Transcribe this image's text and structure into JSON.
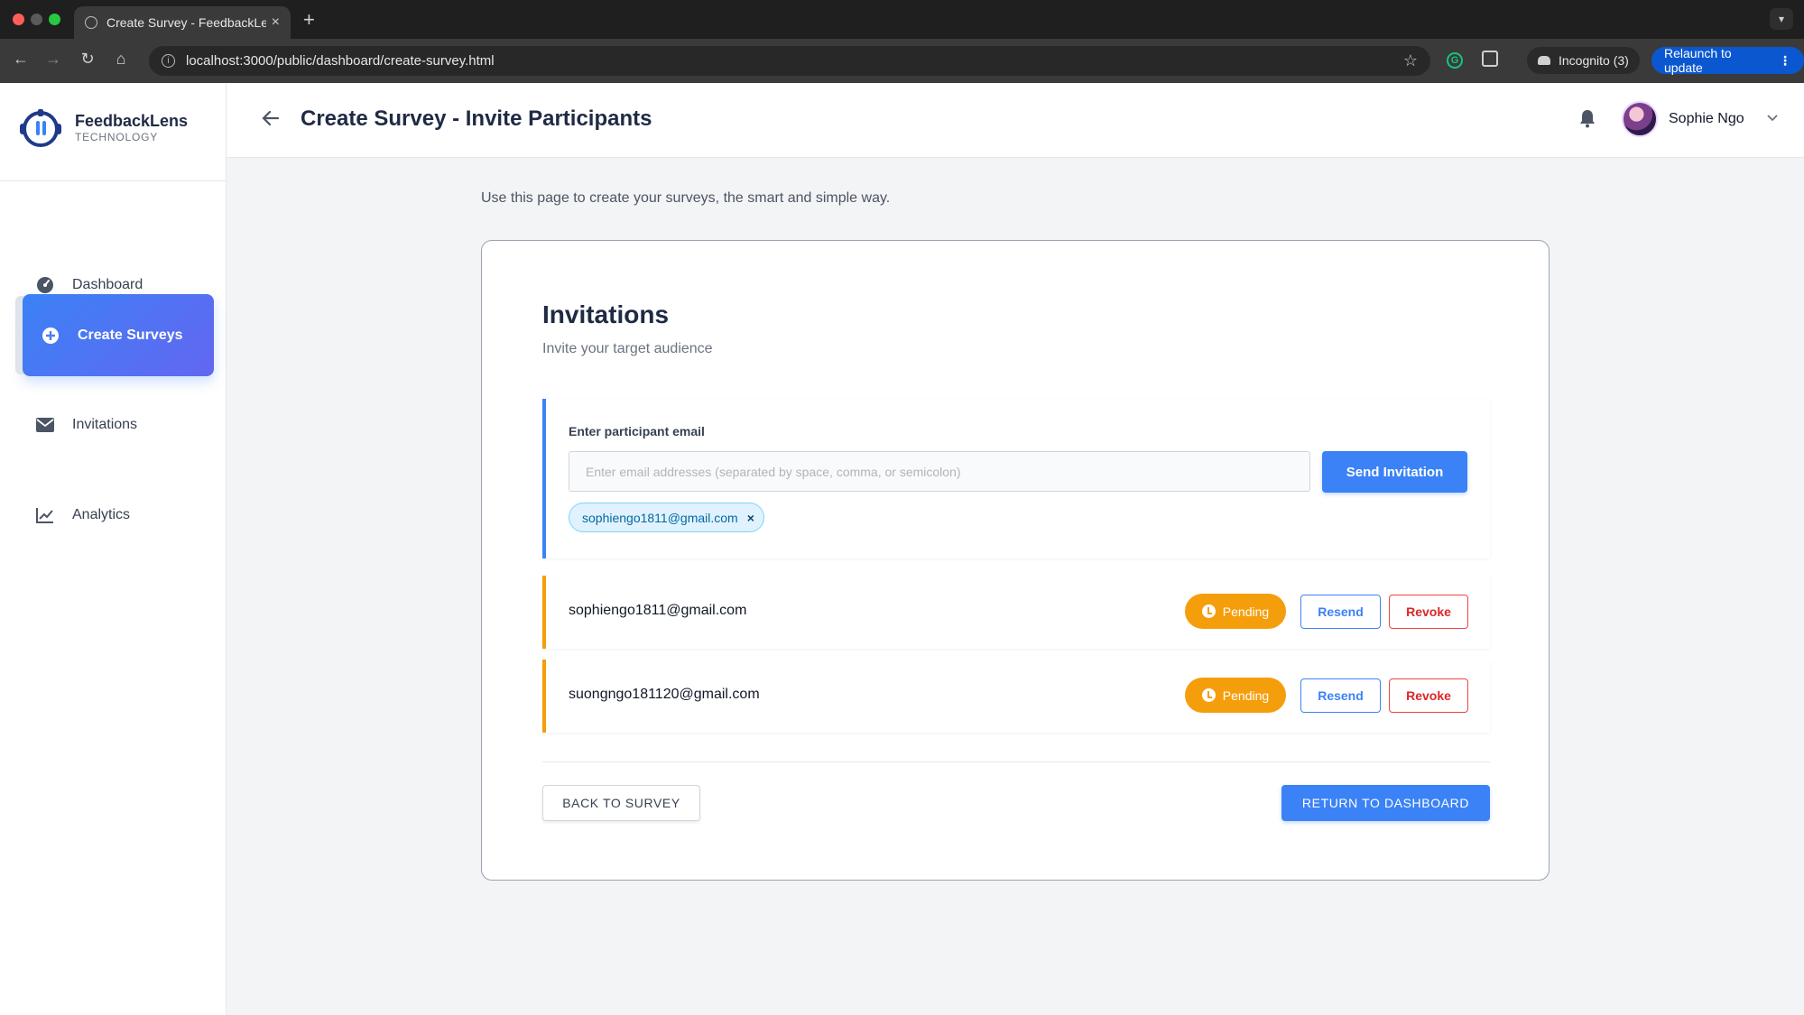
{
  "browser": {
    "tab_title": "Create Survey - FeedbackLens",
    "tab_close": "×",
    "new_tab": "+",
    "url": "localhost:3000/public/dashboard/create-survey.html",
    "incognito_label": "Incognito (3)",
    "relaunch_label": "Relaunch to update",
    "icons": [
      "back-icon",
      "forward-icon",
      "reload-icon",
      "home-icon",
      "site-info-icon",
      "bookmark-star-icon",
      "grammarly-extension-icon",
      "extensions-puzzle-icon",
      "incognito-icon",
      "more-vert-icon"
    ]
  },
  "brand": {
    "name": "FeedbackLens",
    "subtitle": "TECHNOLOGY",
    "color": "#1e3a8a"
  },
  "sidebar": {
    "items": [
      {
        "label": "Dashboard",
        "icon": "gauge-icon",
        "active": false
      },
      {
        "label": "Create Surveys",
        "icon": "plus-circle-icon",
        "active": true
      },
      {
        "label": "Invitations",
        "icon": "envelope-icon",
        "active": false
      },
      {
        "label": "Analytics",
        "icon": "line-chart-icon",
        "active": false
      }
    ]
  },
  "header": {
    "title": "Create Survey - Invite Participants",
    "user_name": "Sophie Ngo"
  },
  "intro": "Use this page to create your surveys, the smart and simple way.",
  "invitations": {
    "title": "Invitations",
    "subtitle": "Invite your target audience",
    "email_label": "Enter participant email",
    "email_placeholder": "Enter email addresses (separated by space, comma, or semicolon)",
    "email_value": "",
    "send_label": "Send Invitation",
    "chips": [
      {
        "email": "sophiengo1811@gmail.com",
        "remove": "×"
      }
    ],
    "list": [
      {
        "email": "sophiengo1811@gmail.com",
        "status": "Pending",
        "resend": "Resend",
        "revoke": "Revoke"
      },
      {
        "email": "suongngo181120@gmail.com",
        "status": "Pending",
        "resend": "Resend",
        "revoke": "Revoke"
      }
    ],
    "back_label": "BACK TO SURVEY",
    "dashboard_label": "RETURN TO DASHBOARD"
  },
  "colors": {
    "accent": "#3b82f6",
    "pending": "#f59e0b",
    "revoke": "#ef4444"
  }
}
